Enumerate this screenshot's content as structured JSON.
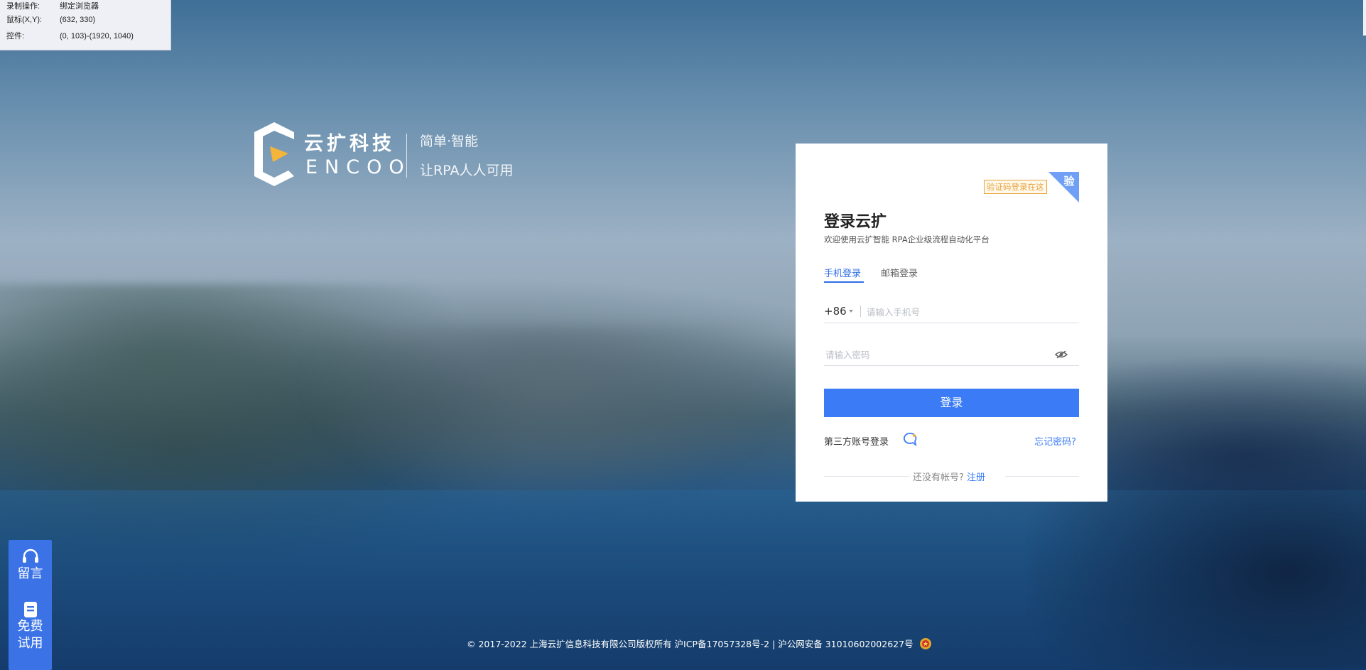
{
  "recorder": {
    "row1_key": "录制操作:",
    "row1_value": "绑定浏览器",
    "row2_key": "鼠标(X,Y):",
    "row2_value": "(632, 330)",
    "row3_key": "控件:",
    "row3_value": "(0, 103)-(1920, 1040)"
  },
  "brand": {
    "cn_name": "云扩科技",
    "en_name": "ENCOO",
    "slogan1": "简单·智能",
    "slogan2": "让RPA人人可用"
  },
  "login": {
    "qr_hint": "验证码登录在这",
    "corner_label": "验",
    "title": "登录云扩",
    "subtitle": "欢迎使用云扩智能 RPA企业级流程自动化平台",
    "tabs": [
      "手机登录",
      "邮箱登录"
    ],
    "country_code": "+86",
    "phone_placeholder": "请输入手机号",
    "password_placeholder": "请输入密码",
    "submit_label": "登录",
    "third_party_label": "第三方账号登录",
    "forgot_label": "忘记密码?",
    "no_account_text": "还没有帐号?",
    "register_label": "注册"
  },
  "side": {
    "item1": "留言",
    "item2_line1": "免费",
    "item2_line2": "试用"
  },
  "footer": {
    "text": "© 2017-2022 上海云扩信息科技有限公司版权所有 沪ICP备17057328号-2 | 沪公网安备 31010602002627号"
  },
  "colors": {
    "primary": "#3b7cf6",
    "hint_orange": "#e8a33d",
    "side_panel": "#3b73e6"
  }
}
